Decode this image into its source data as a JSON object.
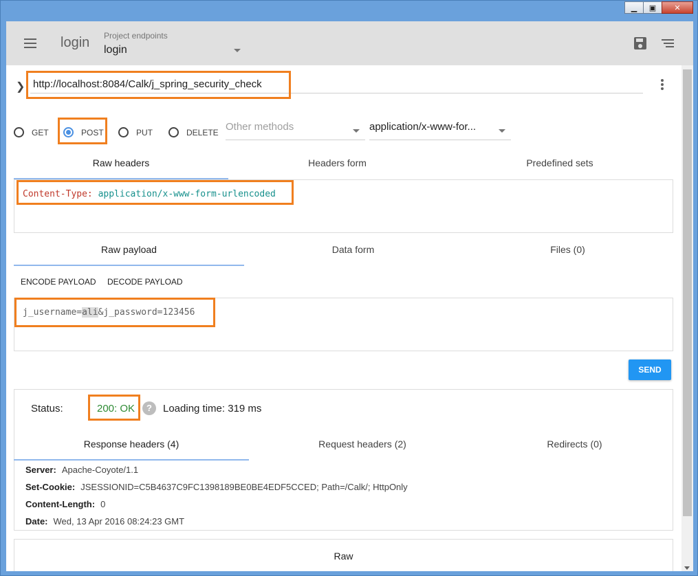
{
  "window": {
    "minimize": "▁",
    "maximize": "▣",
    "close": "✕"
  },
  "toolbar": {
    "title": "login",
    "endpoints_label": "Project endpoints",
    "endpoint_value": "login"
  },
  "request": {
    "url": "http://localhost:8084/Calk/j_spring_security_check",
    "methods": [
      "GET",
      "POST",
      "PUT",
      "DELETE"
    ],
    "selected_method": "POST",
    "other_methods_placeholder": "Other methods",
    "content_type": "application/x-www-for..."
  },
  "headers_tabs": [
    "Raw headers",
    "Headers form",
    "Predefined sets"
  ],
  "headers": {
    "key": "Content-Type:",
    "value": "application/x-www-form-urlencoded"
  },
  "payload_tabs": [
    "Raw payload",
    "Data form",
    "Files (0)"
  ],
  "payload_actions": {
    "encode": "ENCODE PAYLOAD",
    "decode": "DECODE PAYLOAD"
  },
  "payload": {
    "prefix": "j_username=",
    "highlight": "ali",
    "suffix": "&j_password=123456"
  },
  "send_label": "SEND",
  "response": {
    "status_label": "Status:",
    "status_code": "200: OK",
    "help": "?",
    "loading_time": "Loading time: 319 ms",
    "tabs": [
      "Response headers (4)",
      "Request headers (2)",
      "Redirects (0)"
    ],
    "headers": [
      {
        "name": "Server:",
        "value": "Apache-Coyote/1.1"
      },
      {
        "name": "Set-Cookie:",
        "value": "JSESSIONID=C5B4637C9FC1398189BE0BE4EDF5CCED; Path=/Calk/; HttpOnly"
      },
      {
        "name": "Content-Length:",
        "value": "0"
      },
      {
        "name": "Date:",
        "value": "Wed, 13 Apr 2016 08:24:23 GMT"
      }
    ],
    "raw_tab": "Raw"
  },
  "colors": {
    "highlight_border": "#f07f1f",
    "accent": "#2196f3",
    "status_ok": "#2e8b34"
  }
}
